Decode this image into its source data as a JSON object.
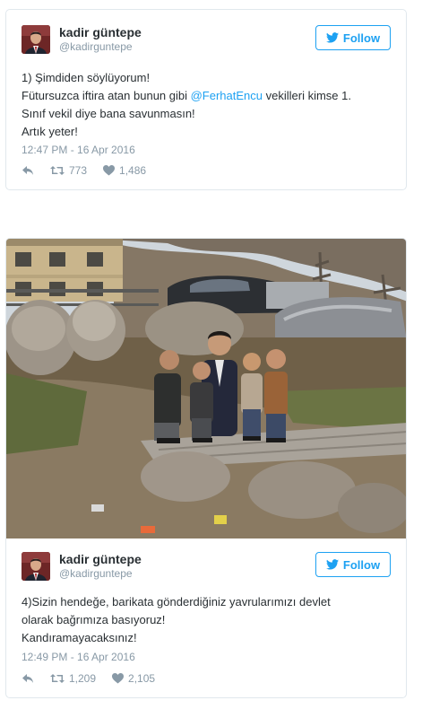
{
  "tweets": [
    {
      "display_name": "kadir güntepe",
      "handle": "@kadirguntepe",
      "follow_label": "Follow",
      "text_lines": [
        {
          "pre": "1) Şimdiden söylüyorum!"
        },
        {
          "pre": "Fütursuzca iftira atan bunun gibi ",
          "mention": "@FerhatEncu",
          "post": " vekilleri kimse 1."
        },
        {
          "pre": "Sınıf vekil diye bana savunmasın!"
        },
        {
          "pre": "Artık yeter!"
        }
      ],
      "timestamp": "12:47 PM - 16 Apr 2016",
      "retweets": "773",
      "likes": "1,486"
    },
    {
      "display_name": "kadir güntepe",
      "handle": "@kadirguntepe",
      "follow_label": "Follow",
      "text_lines": [
        {
          "pre": "4)Sizin hendeğe, barikata gönderdiğiniz yavrularımızı devlet"
        },
        {
          "pre": "olarak bağrımıza basıyoruz!"
        },
        {
          "pre": "Kandıramayacaksınız!"
        }
      ],
      "timestamp": "12:49 PM - 16 Apr 2016",
      "retweets": "1,209",
      "likes": "2,105"
    }
  ],
  "icons": {
    "twitter": "twitter-bird-icon",
    "reply": "reply-icon",
    "retweet": "retweet-icon",
    "like": "heart-icon"
  },
  "colors": {
    "accent": "#1da1f2",
    "meta": "#8899a6",
    "text": "#292f33",
    "border": "#e1e8ed"
  }
}
